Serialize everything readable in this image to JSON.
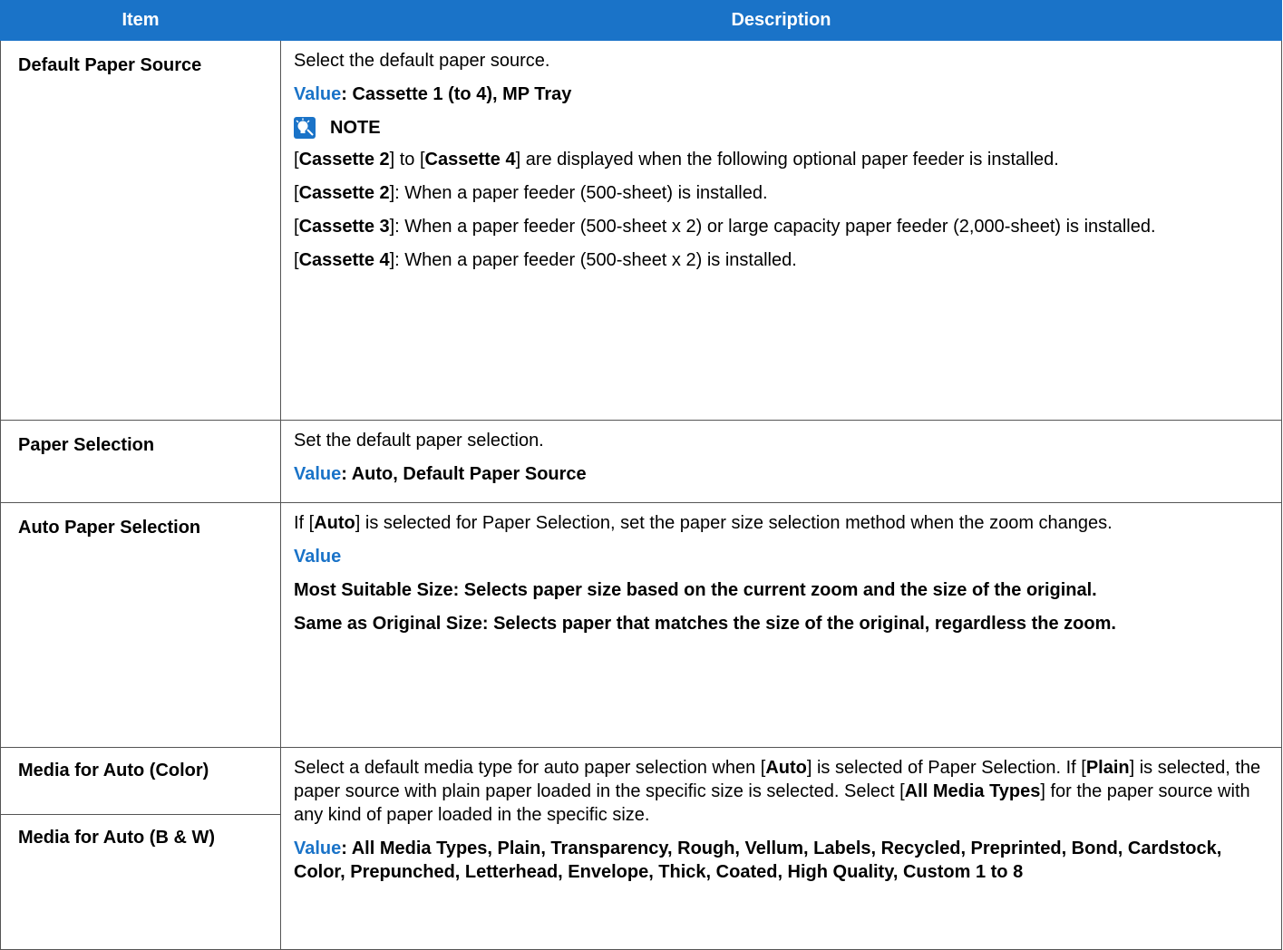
{
  "header": {
    "item": "Item",
    "description": "Description"
  },
  "rows": {
    "default_paper_source": {
      "item": "Default Paper Source",
      "desc": "Select the default paper source.",
      "value_label": "Value",
      "value_text": ": Cassette 1 (to 4), MP Tray",
      "note_title": "NOTE",
      "note_intro": {
        "b1": "[",
        "k1": "Cassette 2",
        "b2": "] to [",
        "k2": "Cassette 4",
        "b3": "] are displayed when the following optional paper feeder is installed."
      },
      "note_c2": {
        "open": "[",
        "key": "Cassette 2",
        "close": "]: When a paper feeder (500-sheet) is installed."
      },
      "note_c3": {
        "open": "[",
        "key": "Cassette 3",
        "close": "]: When a paper feeder (500-sheet x 2) or large capacity paper feeder (2,000-sheet) is installed."
      },
      "note_c4": {
        "open": "[",
        "key": "Cassette 4",
        "close": "]: When a paper feeder (500-sheet x 2) is installed."
      }
    },
    "paper_selection": {
      "item": "Paper Selection",
      "desc": "Set the default paper selection.",
      "value_label": "Value",
      "value_text": ": Auto, Default Paper Source"
    },
    "auto_paper_selection": {
      "item": "Auto Paper Selection",
      "desc_pre": "If [",
      "desc_key": "Auto",
      "desc_post": "] is selected for Paper Selection, set the paper size selection method when the zoom changes.",
      "value_label": "Value",
      "opt1": "Most Suitable Size: Selects paper size based on the current zoom and the size of the original.",
      "opt2": "Same as Original Size: Selects paper that matches the size of the original, regardless the zoom."
    },
    "media_for_auto": {
      "item_color": "Media for Auto (Color)",
      "item_bw": "Media for Auto (B & W)",
      "d1": "Select a default media type for auto paper selection when [",
      "k1": "Auto",
      "d2": "] is selected of Paper Selection. If [",
      "k2": "Plain",
      "d3": "] is selected, the paper source with plain paper loaded in the specific size is selected. Select [",
      "k3": "All Media Types",
      "d4": "] for the paper source with any kind of paper loaded in the specific size.",
      "value_label": "Value",
      "value_text": ": All Media Types, Plain, Transparency, Rough, Vellum, Labels, Recycled, Preprinted, Bond, Cardstock, Color, Prepunched, Letterhead, Envelope, Thick, Coated, High Quality, Custom 1 to 8"
    }
  },
  "icons": {
    "note": "note-lightbulb-icon"
  },
  "colors": {
    "accent": "#1a73c8",
    "header_text": "#ffffff",
    "border": "#555555"
  }
}
